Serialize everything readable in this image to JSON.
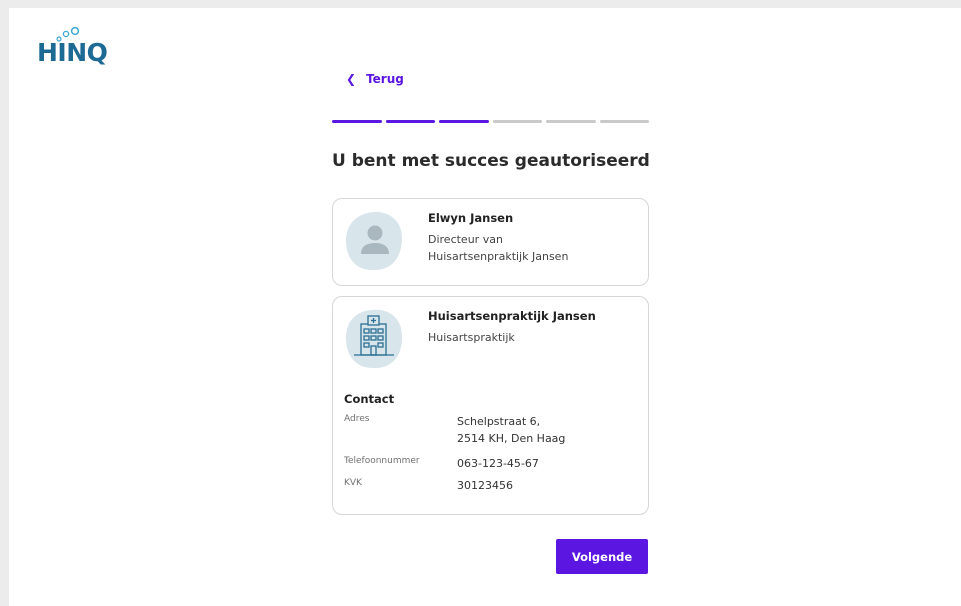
{
  "brand": {
    "logo_text": "HINQ",
    "color": "#1d6b95"
  },
  "nav": {
    "back_label": "Terug"
  },
  "progress": {
    "total_steps": 6,
    "completed_steps": 3
  },
  "page": {
    "title": "U bent met succes geautoriseerd"
  },
  "person": {
    "name": "Elwyn Jansen",
    "role": "Directeur van",
    "organization": "Huisartsenpraktijk Jansen",
    "icon": "user-avatar-icon"
  },
  "organization": {
    "name": "Huisartsenpraktijk Jansen",
    "type": "Huisartspraktijk",
    "icon": "building-icon",
    "contact": {
      "heading": "Contact",
      "address_label": "Adres",
      "address_line1": "Schelpstraat 6,",
      "address_line2": "2514 KH, Den Haag",
      "phone_label": "Telefoonnummer",
      "phone": "063-123-45-67",
      "kvk_label": "KVK",
      "kvk": "30123456"
    }
  },
  "actions": {
    "next_label": "Volgende"
  },
  "colors": {
    "accent": "#5b16e2",
    "icon_bg": "#d8e6ec",
    "inactive_step": "#c9c9c9"
  }
}
